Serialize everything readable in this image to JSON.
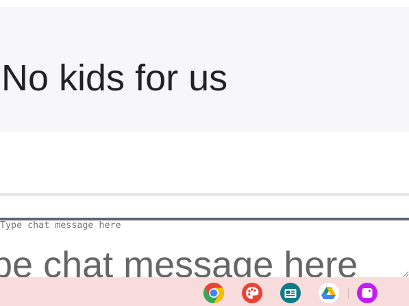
{
  "message": {
    "text": "No kids for us"
  },
  "composer": {
    "placeholder": "Type chat message here",
    "visible_placeholder": "pe chat message here"
  },
  "taskbar": {
    "apps": [
      {
        "name": "chrome-icon",
        "label": "Chrome"
      },
      {
        "name": "canvas-icon",
        "label": "Canvas"
      },
      {
        "name": "news-icon",
        "label": "News"
      },
      {
        "name": "drive-icon",
        "label": "Drive"
      },
      {
        "name": "app-icon",
        "label": "App"
      }
    ],
    "colors": {
      "background": "#f8dcdc",
      "chrome_red": "#ea4335",
      "chrome_yellow": "#fbbc05",
      "chrome_green": "#34a853",
      "chrome_blue": "#4285f4",
      "canvas": "#ea4335",
      "news": "#0e7c86",
      "drive_green": "#0f9d58",
      "drive_yellow": "#f4b400",
      "drive_blue": "#4285f4",
      "app": "#c21cf2"
    }
  }
}
